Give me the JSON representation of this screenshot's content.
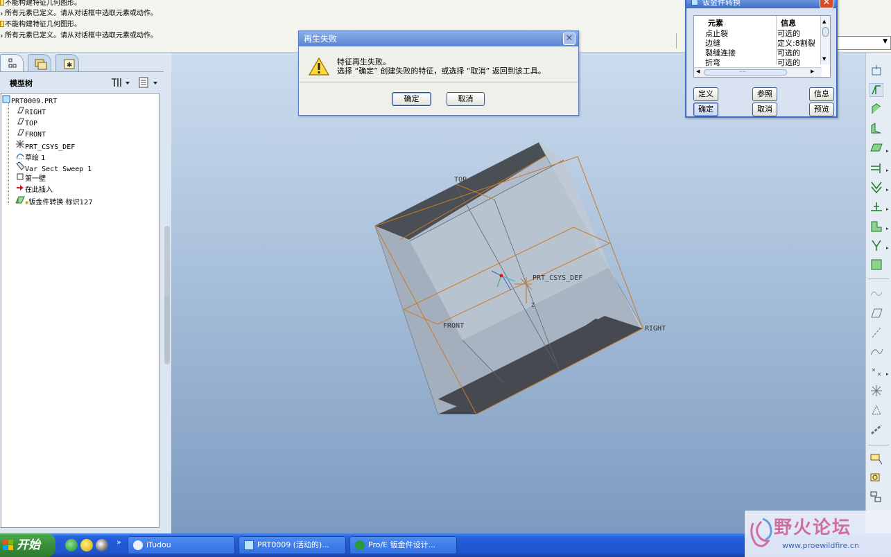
{
  "messages": [
    {
      "icon": "warn",
      "text": "不能构建特征几何图形。"
    },
    {
      "icon": "arrow",
      "text": "所有元素已定义。请从对话框中选取元素或动作。"
    },
    {
      "icon": "warn",
      "text": "不能构建特征几何图形。"
    },
    {
      "icon": "arrow",
      "text": "所有元素已定义。请从对话框中选取元素或动作。"
    }
  ],
  "left_panel": {
    "tree_title": "模型树",
    "tree_items": [
      {
        "icon": "part-icon",
        "label": "PRT0009.PRT"
      },
      {
        "icon": "datum-plane-icon",
        "label": "RIGHT"
      },
      {
        "icon": "datum-plane-icon",
        "label": "TOP"
      },
      {
        "icon": "datum-plane-icon",
        "label": "FRONT"
      },
      {
        "icon": "csys-icon",
        "label": "PRT_CSYS_DEF"
      },
      {
        "icon": "sketch-icon",
        "label": "草绘 1"
      },
      {
        "icon": "sweep-icon",
        "label": "Var Sect Sweep 1"
      },
      {
        "icon": "first-wall-icon",
        "label": "第一壁"
      },
      {
        "icon": "insert-here-icon",
        "label": "在此插入"
      },
      {
        "icon": "sheetmetal-convert-icon",
        "label": "钣金件转换 标识127"
      }
    ]
  },
  "viewport": {
    "datum_labels": {
      "top": "TOP",
      "front": "FRONT",
      "right": "RIGHT",
      "csys": "PRT_CSYS_DEF",
      "axis_z": "Z"
    },
    "colors": {
      "datum": "#c87a28",
      "face_light": "#b4bfcc",
      "face_mid": "#9fabb8",
      "face_dark": "#4a4e55",
      "edge": "#5a6570"
    }
  },
  "regen_dialog": {
    "title": "再生失败",
    "line1": "特征再生失败。",
    "line2": "选择 “确定” 创建失败的特征，或选择 “取消” 返回到该工具。",
    "ok": "确定",
    "cancel": "取消"
  },
  "sheet_dialog": {
    "title": "钣金件转换",
    "col_element": "元素",
    "col_info": "信息",
    "rows": [
      {
        "element": "点止裂",
        "info": "可选的"
      },
      {
        "element": "边缝",
        "info": "定义:8割裂"
      },
      {
        "element": "裂缝连接",
        "info": "可选的"
      },
      {
        "element": "折弯",
        "info": "可选的"
      }
    ],
    "hscroll_glyph": "....",
    "buttons": {
      "define": "定义",
      "refs": "参照",
      "info": "信息",
      "ok": "确定",
      "cancel": "取消",
      "preview": "预览"
    }
  },
  "taskbar": {
    "start": "开始",
    "more": "»",
    "tasks": [
      {
        "label": "iTudou"
      },
      {
        "label": "PRT0009 (活动的)..."
      },
      {
        "label": "Pro/E 钣金件设计..."
      }
    ]
  },
  "watermark": {
    "text": "野火论坛",
    "url": "www.proewildfire.cn"
  }
}
